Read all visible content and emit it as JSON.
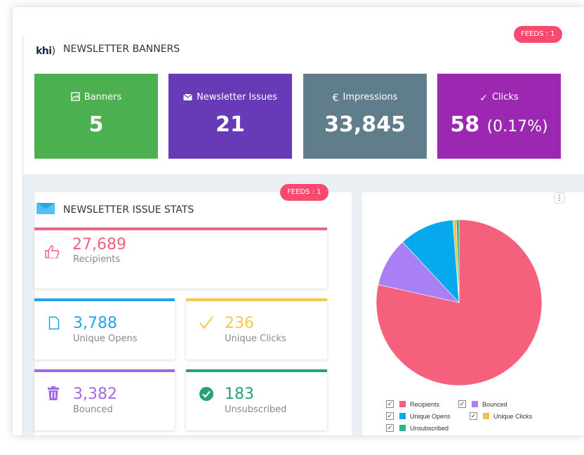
{
  "header": {
    "logo_text": "khi",
    "title": "NEWSLETTER BANNERS",
    "feeds_badge": "FEEDS : 1"
  },
  "stats": [
    {
      "label": "Banners",
      "value": "5",
      "icon": "image-icon",
      "color": "#4caf50"
    },
    {
      "label": "Newsletter Issues",
      "value": "21",
      "icon": "envelope-icon",
      "color": "#673ab7"
    },
    {
      "label": "Impressions",
      "value": "33,845",
      "icon": "euro-icon",
      "color": "#607d8b"
    },
    {
      "label": "Clicks",
      "value": "58",
      "value_suffix": "(0.17%)",
      "icon": "check-icon",
      "color": "#9c27b0"
    }
  ],
  "issue_stats": {
    "title": "NEWSLETTER ISSUE STATS",
    "feeds_badge": "FEEDS : 1",
    "icon": "mail-icon",
    "cards": [
      {
        "value": "27,689",
        "label": "Recipients",
        "icon": "thumbs-up-icon",
        "color": "#f06280"
      },
      {
        "value": "3,788",
        "label": "Unique Opens",
        "icon": "document-icon",
        "color": "#1ea6e8"
      },
      {
        "value": "236",
        "label": "Unique Clicks",
        "icon": "checkmark-icon",
        "color": "#f7c948"
      },
      {
        "value": "3,382",
        "label": "Bounced",
        "icon": "trash-icon",
        "color": "#a06be0"
      },
      {
        "value": "183",
        "label": "Unsubscribed",
        "icon": "check-circle-icon",
        "color": "#26a17b"
      }
    ]
  },
  "chart_menu": "⋮",
  "chart_data": {
    "type": "pie",
    "labels": [
      "Recipients",
      "Bounced",
      "Unique Opens",
      "Unique Clicks",
      "Unsubscribed"
    ],
    "values": [
      27689,
      3382,
      3788,
      236,
      183
    ],
    "colors": [
      "#f5607c",
      "#a97ff5",
      "#06a9ee",
      "#f5c04a",
      "#2bb38b"
    ],
    "legend_position": "bottom"
  }
}
